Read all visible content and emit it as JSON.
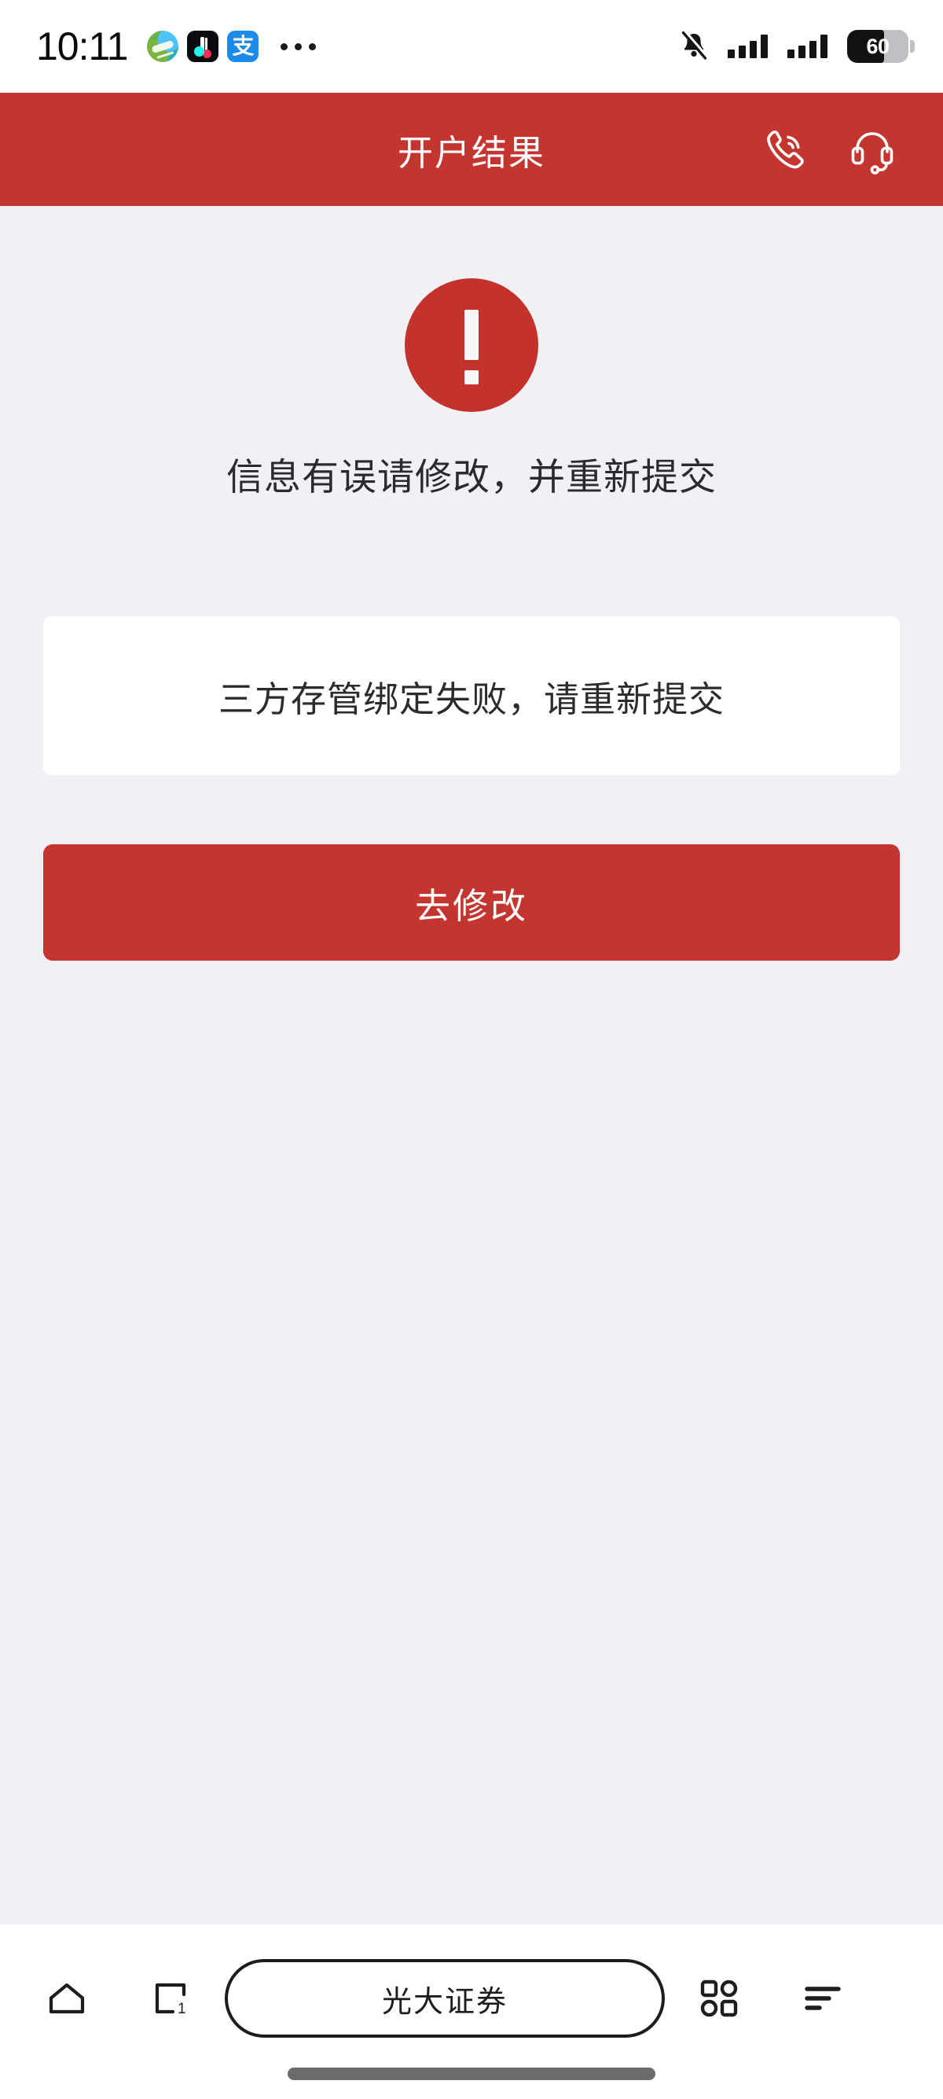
{
  "status_bar": {
    "time": "10:11",
    "app_icons": [
      "globe-app-icon",
      "douyin-app-icon",
      "alipay-app-icon"
    ],
    "alipay_glyph": "支",
    "overflow": "...",
    "mute_icon": "bell-muted-icon",
    "signal_icons": [
      "signal-bars-icon",
      "signal-bars-icon"
    ],
    "battery_level": "60",
    "battery_percent": 60
  },
  "header": {
    "title": "开户结果",
    "actions": [
      {
        "name": "phone-call-icon",
        "label": "电话"
      },
      {
        "name": "headset-support-icon",
        "label": "客服"
      }
    ],
    "background_color": "#C43530"
  },
  "main": {
    "status_icon": "error-exclamation-icon",
    "status_icon_color": "#C4322C",
    "title": "信息有误请修改，并重新提交",
    "card_message": "三方存管绑定失败，请重新提交",
    "primary_button": "去修改",
    "primary_button_color": "#C43530",
    "background_color": "#F0F0F5"
  },
  "bottom_bar": {
    "home_icon": "home-icon",
    "tabs_icon": "tab-switcher-icon",
    "tabs_count": "1",
    "app_name": "光大证券",
    "grid_icon": "apps-grid-icon",
    "menu_icon": "menu-list-icon"
  }
}
